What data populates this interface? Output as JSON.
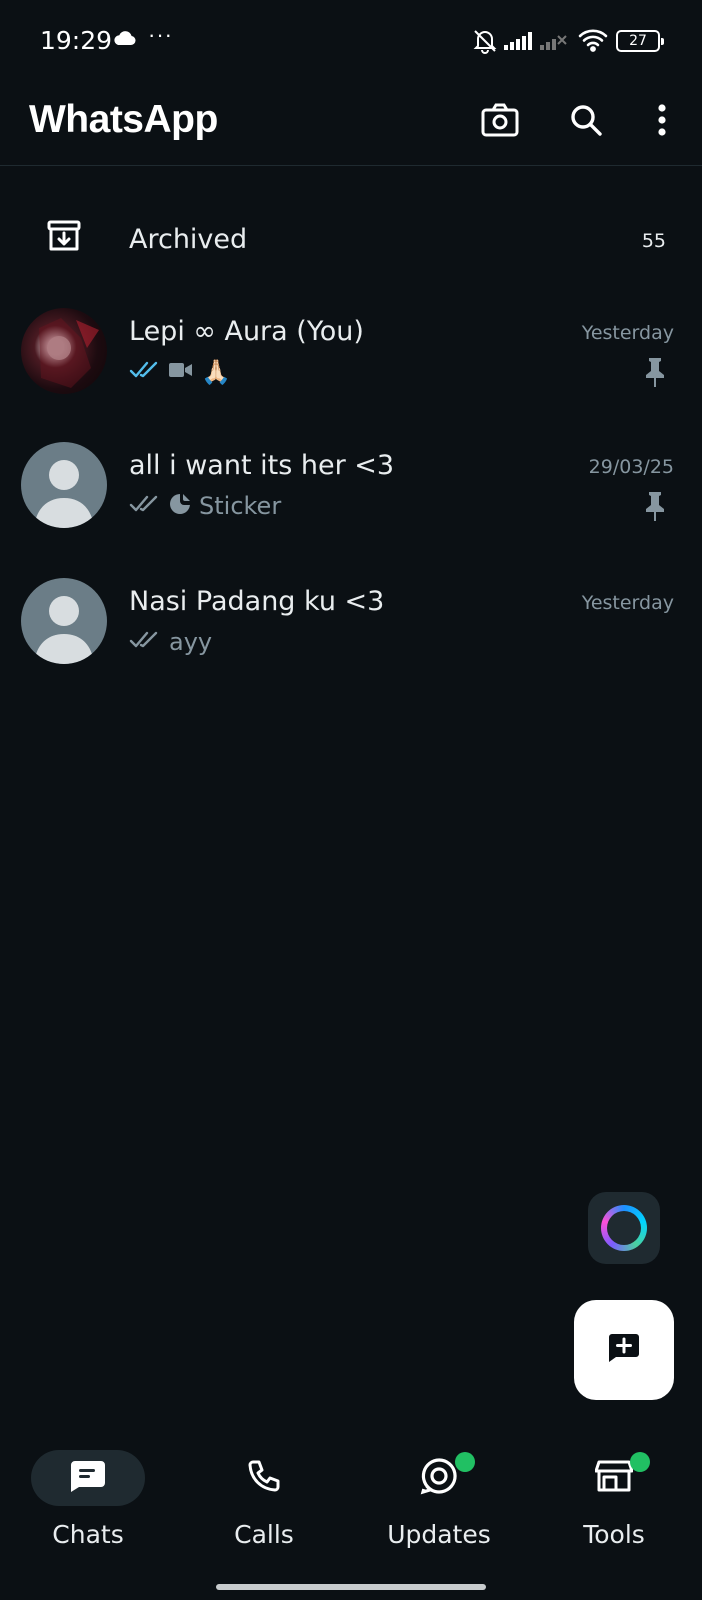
{
  "status_bar": {
    "time": "19:29",
    "dots": "···",
    "battery": "27"
  },
  "header": {
    "title": "WhatsApp",
    "icons": [
      "camera-icon",
      "search-icon",
      "more-vert-icon"
    ]
  },
  "archived": {
    "label": "Archived",
    "count": "55"
  },
  "chats": [
    {
      "name": "Lepi ∞ Aura (You)",
      "time": "Yesterday",
      "preview_icons": [
        "read-ticks-icon",
        "video-icon"
      ],
      "preview_text": "🙏🏻",
      "pinned": true,
      "ticks_color": "#53bdeb"
    },
    {
      "name": "all i want its her <3",
      "time": "29/03/25",
      "preview_icons": [
        "delivered-ticks-icon",
        "sticker-icon"
      ],
      "preview_text": "Sticker",
      "pinned": true,
      "ticks_color": "#8696a0"
    },
    {
      "name": "Nasi Padang ku <3",
      "time": "Yesterday",
      "preview_icons": [
        "delivered-ticks-icon"
      ],
      "preview_text": "ayy",
      "pinned": false,
      "ticks_color": "#8696a0"
    }
  ],
  "nav": {
    "items": [
      {
        "label": "Chats",
        "icon": "chats-icon",
        "active": true
      },
      {
        "label": "Calls",
        "icon": "phone-icon",
        "active": false
      },
      {
        "label": "Updates",
        "icon": "updates-icon",
        "active": false,
        "badge": true
      },
      {
        "label": "Tools",
        "icon": "store-icon",
        "active": false,
        "badge": true
      }
    ]
  },
  "colors": {
    "background": "#0b1014",
    "accent_green": "#21c063",
    "muted_text": "#8696a0",
    "read_blue": "#53bdeb"
  }
}
